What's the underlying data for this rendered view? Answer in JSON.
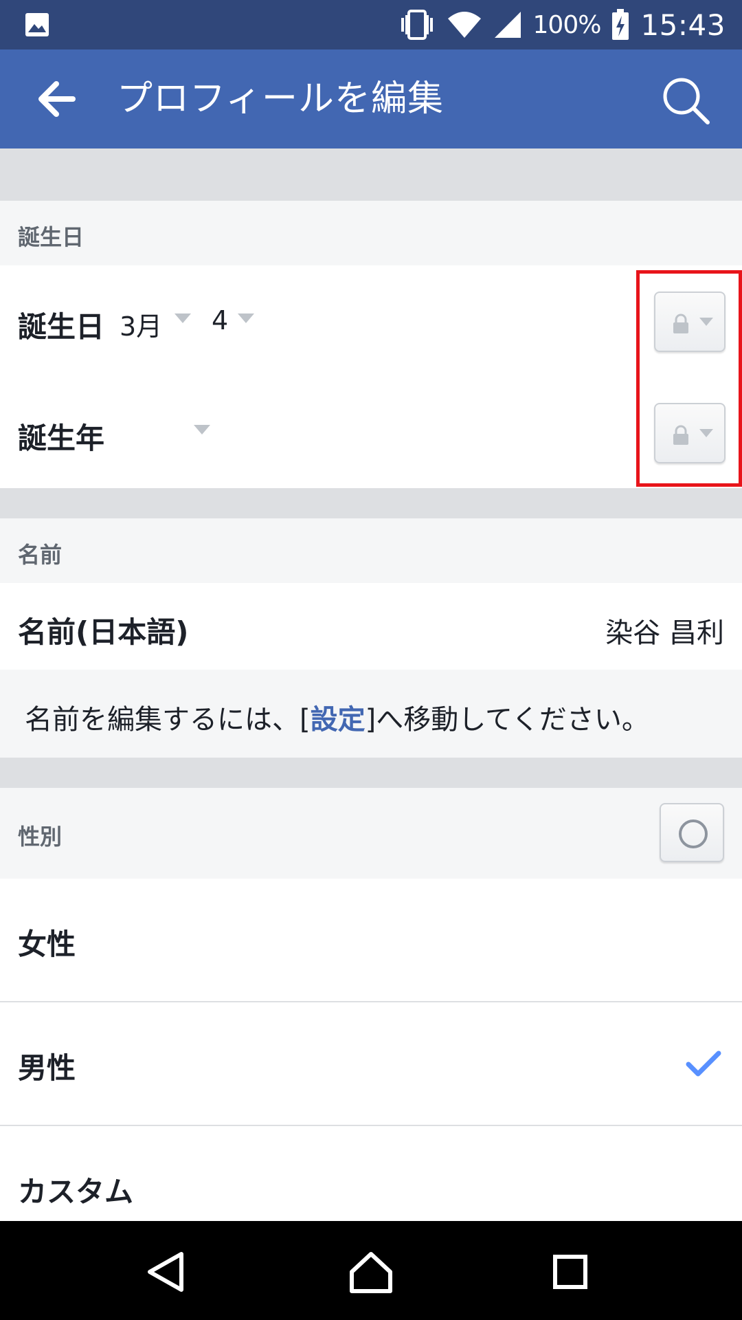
{
  "status_bar": {
    "battery_pct": "100%",
    "time": "15:43"
  },
  "app_bar": {
    "title": "プロフィールを編集"
  },
  "birthday_section": {
    "header": "誕生日",
    "birthday_label": "誕生日",
    "month": "3月",
    "day": "4",
    "year_label": "誕生年",
    "year_value": ""
  },
  "name_section": {
    "header": "名前",
    "label": "名前(日本語)",
    "value": "染谷 昌利",
    "note_before": "名前を編集するには、[",
    "note_link": "設定",
    "note_after": "]へ移動してください。"
  },
  "gender_section": {
    "header": "性別",
    "options": [
      {
        "label": "女性",
        "selected": false
      },
      {
        "label": "男性",
        "selected": true
      },
      {
        "label": "カスタム",
        "selected": false
      }
    ]
  },
  "colors": {
    "brand": "#4267b2",
    "status_bar": "#30477a",
    "highlight": "#e8141a"
  }
}
